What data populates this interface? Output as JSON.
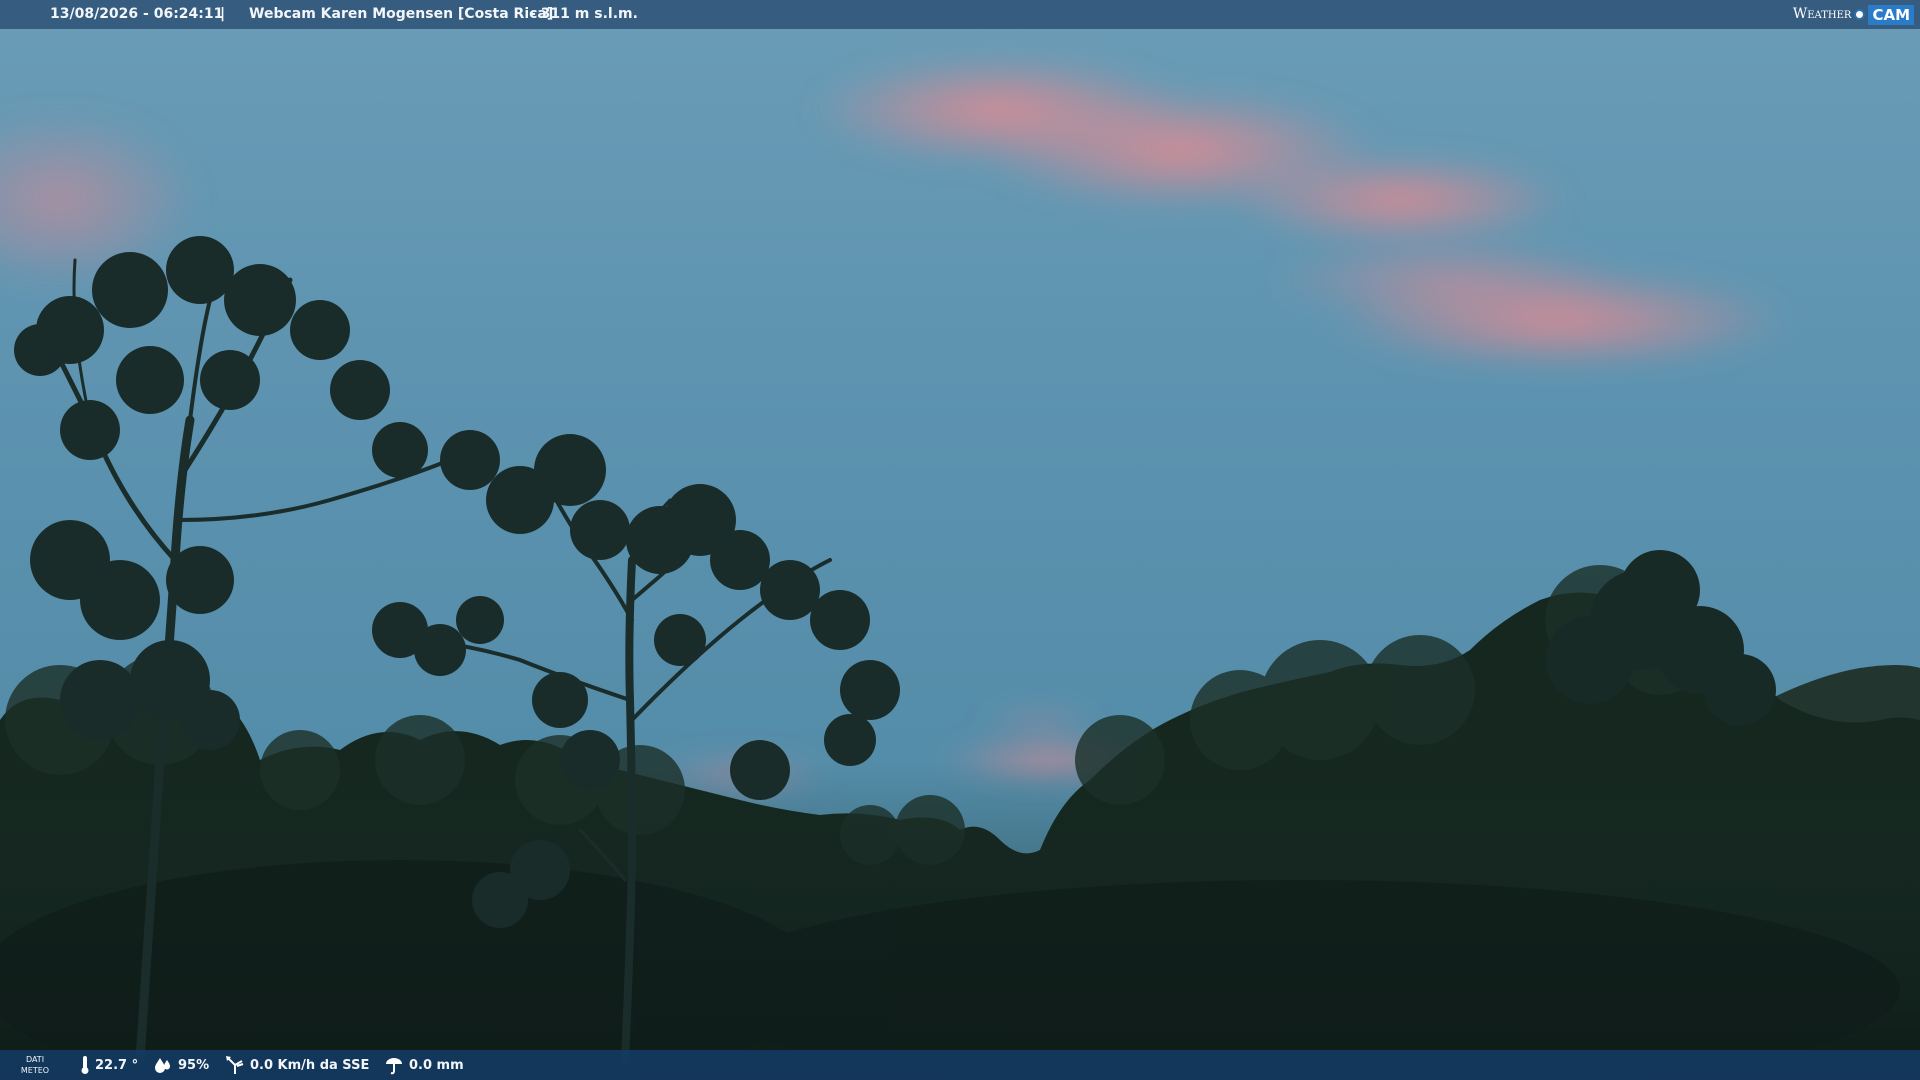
{
  "overlay_top": {
    "datetime": "13/08/2026 - 06:24:11",
    "separator": "|",
    "camera_title": "Webcam Karen Mogensen [Costa Rica]",
    "altitude": "- 311 m s.l.m."
  },
  "brand": {
    "word": "Weather",
    "cam": "CAM"
  },
  "overlay_bottom": {
    "meteo_line1": "DATI",
    "meteo_line2": "METEO",
    "temperature": "22.7 °",
    "humidity": "95%",
    "wind": "0.0 Km/h da SSE",
    "rain": "0.0 mm"
  },
  "colors": {
    "sky_top": "#5f97b4",
    "sky_bottom": "#4f86a4",
    "cloud_pink": "#e0848c",
    "foliage_dark": "#11221f",
    "bar_top": "#284a70",
    "bar_bottom": "#143a64"
  },
  "icons": {
    "thermometer": "thermometer-icon",
    "humidity": "water-drops-icon",
    "wind": "wind-vane-icon",
    "rain": "rain-umbrella-icon"
  }
}
